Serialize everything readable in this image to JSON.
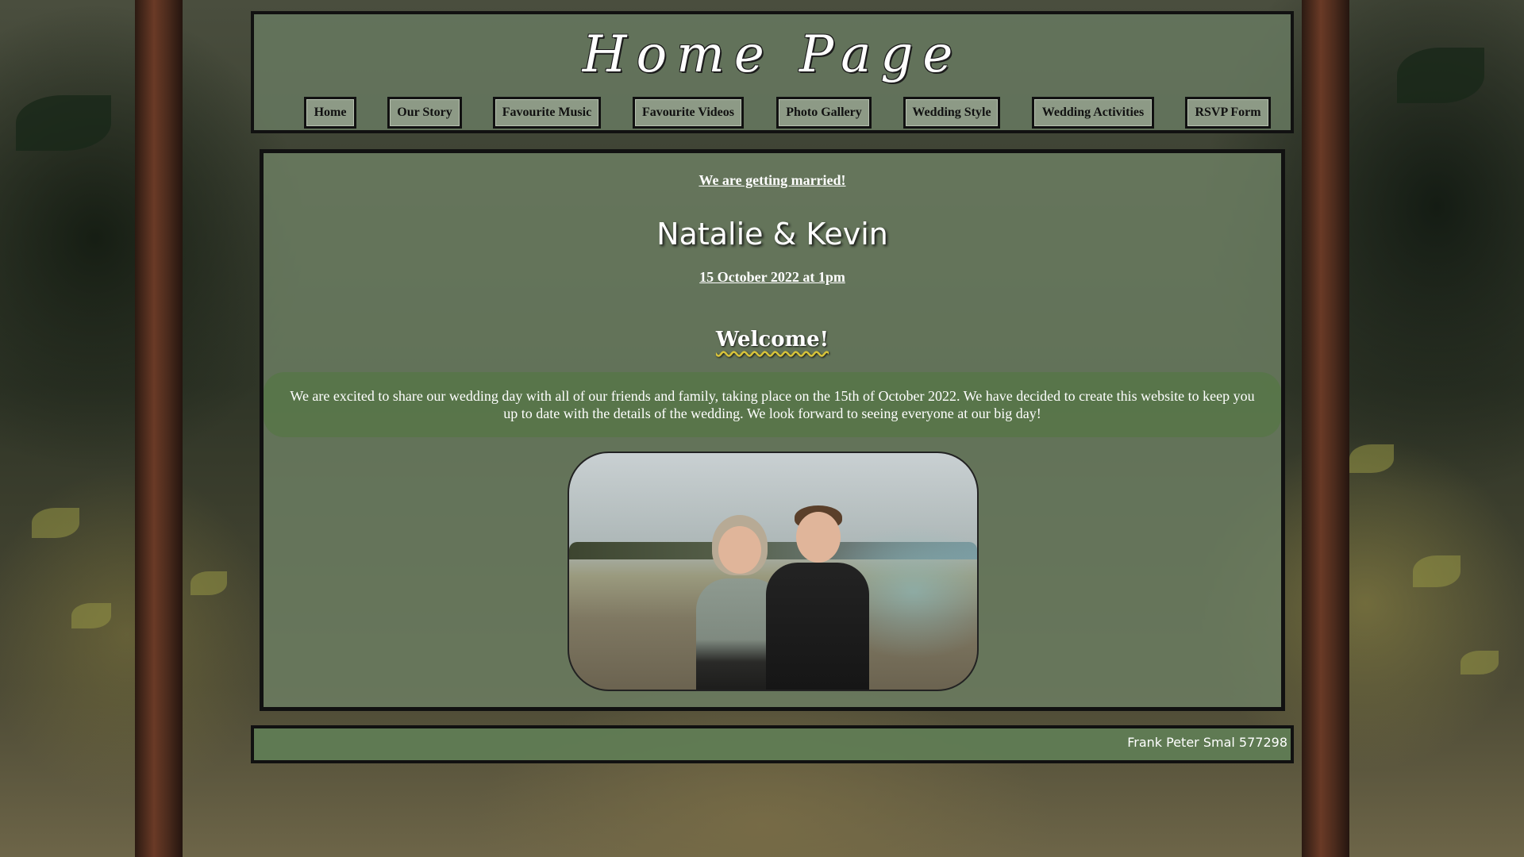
{
  "header": {
    "title": "Home Page"
  },
  "nav": {
    "items": [
      {
        "label": "Home"
      },
      {
        "label": "Our Story"
      },
      {
        "label": "Favourite Music"
      },
      {
        "label": "Favourite Videos"
      },
      {
        "label": "Photo Gallery"
      },
      {
        "label": "Wedding Style"
      },
      {
        "label": "Wedding Activities"
      },
      {
        "label": "RSVP Form"
      }
    ]
  },
  "main": {
    "tagline": "We are getting married!",
    "couple": "Natalie & Kevin",
    "date": "15 October 2022 at 1pm",
    "welcome": "Welcome!",
    "intro": "We are excited to share our wedding day with all of our friends and family, taking place on the 15th of October 2022. We have decided to create this website to keep you up to date with the details of the wedding. We look forward to seeing everyone at our big day!"
  },
  "footer": {
    "credit": "Frank Peter Smal 577298"
  },
  "colors": {
    "panel": "#6e8064",
    "footer": "#607c54",
    "border": "#111111",
    "nav_button": "#8d9a86"
  }
}
